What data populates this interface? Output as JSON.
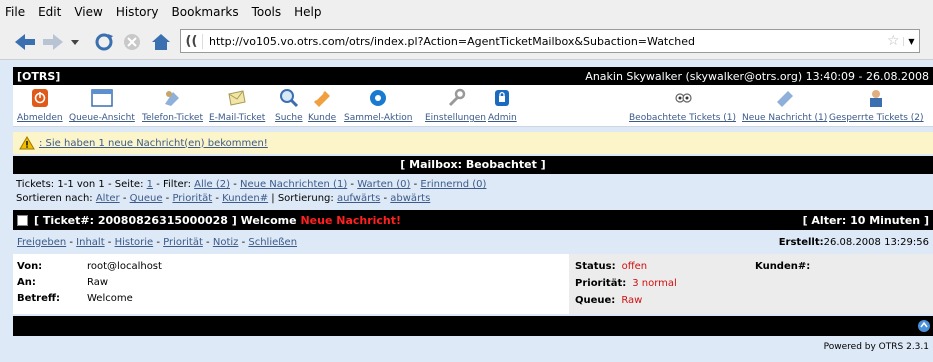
{
  "browser": {
    "menu": [
      "File",
      "Edit",
      "View",
      "History",
      "Bookmarks",
      "Tools",
      "Help"
    ],
    "identity": "((",
    "url": "http://vo105.vo.otrs.com/otrs/index.pl?Action=AgentTicketMailbox&Subaction=Watched"
  },
  "header": {
    "brand": "[OTRS]",
    "user": "Anakin Skywalker (skywalker@otrs.org) 13:40:09 - 26.08.2008"
  },
  "toolbar": {
    "left": [
      "Abmelden",
      "Queue-Ansicht",
      "Telefon-Ticket",
      "E-Mail-Ticket",
      "Suche",
      "Kunde",
      "Sammel-Aktion"
    ],
    "middle": [
      "Einstellungen",
      "Admin"
    ],
    "right": [
      "Beobachtete Tickets (1)",
      "Neue Nachricht (1)",
      "Gesperrte Tickets (2)"
    ]
  },
  "notification": ": Sie haben 1 neue Nachricht(en) bekommen!",
  "mailbox_title": "[ Mailbox: Beobachtet ]",
  "tickets_line": {
    "prefix": "Tickets: 1-1 von 1 - Seite: ",
    "page": "1",
    "filter_label": " - Filter: ",
    "filters": [
      "Alle (2)",
      "Neue Nachrichten (1)",
      "Warten (0)",
      "Erinnernd (0)"
    ]
  },
  "sort_line": {
    "prefix": "Sortieren nach: ",
    "options": [
      "Alter",
      "Queue",
      "Priorität",
      "Kunden#"
    ],
    "order_label": " | Sortierung: ",
    "orders": [
      "aufwärts",
      "abwärts"
    ]
  },
  "ticket": {
    "title": "[ Ticket#: 20080826315000028 ] Welcome",
    "new_label": "Neue Nachricht!",
    "age": "[ Alter: 10 Minuten ]",
    "actions": [
      "Freigeben",
      "Inhalt",
      "Historie",
      "Priorität",
      "Notiz",
      "Schließen"
    ],
    "created_label": "Erstellt:",
    "created_value": "26.08.2008 13:29:56",
    "from_label": "Von:",
    "from": "root@localhost",
    "to_label": "An:",
    "to": "Raw",
    "subject_label": "Betreff:",
    "subject": "Welcome",
    "status_label": "Status:",
    "status": "offen",
    "priority_label": "Priorität:",
    "priority": "3 normal",
    "queue_label": "Queue:",
    "queue": "Raw",
    "customer_label": "Kunden#:",
    "customer": ""
  },
  "footer": "Powered by OTRS 2.3.1",
  "colors": {
    "link": "#3c5a8a",
    "new": "#ff2020",
    "status": "#d01010",
    "bg": "#dde9f6"
  }
}
